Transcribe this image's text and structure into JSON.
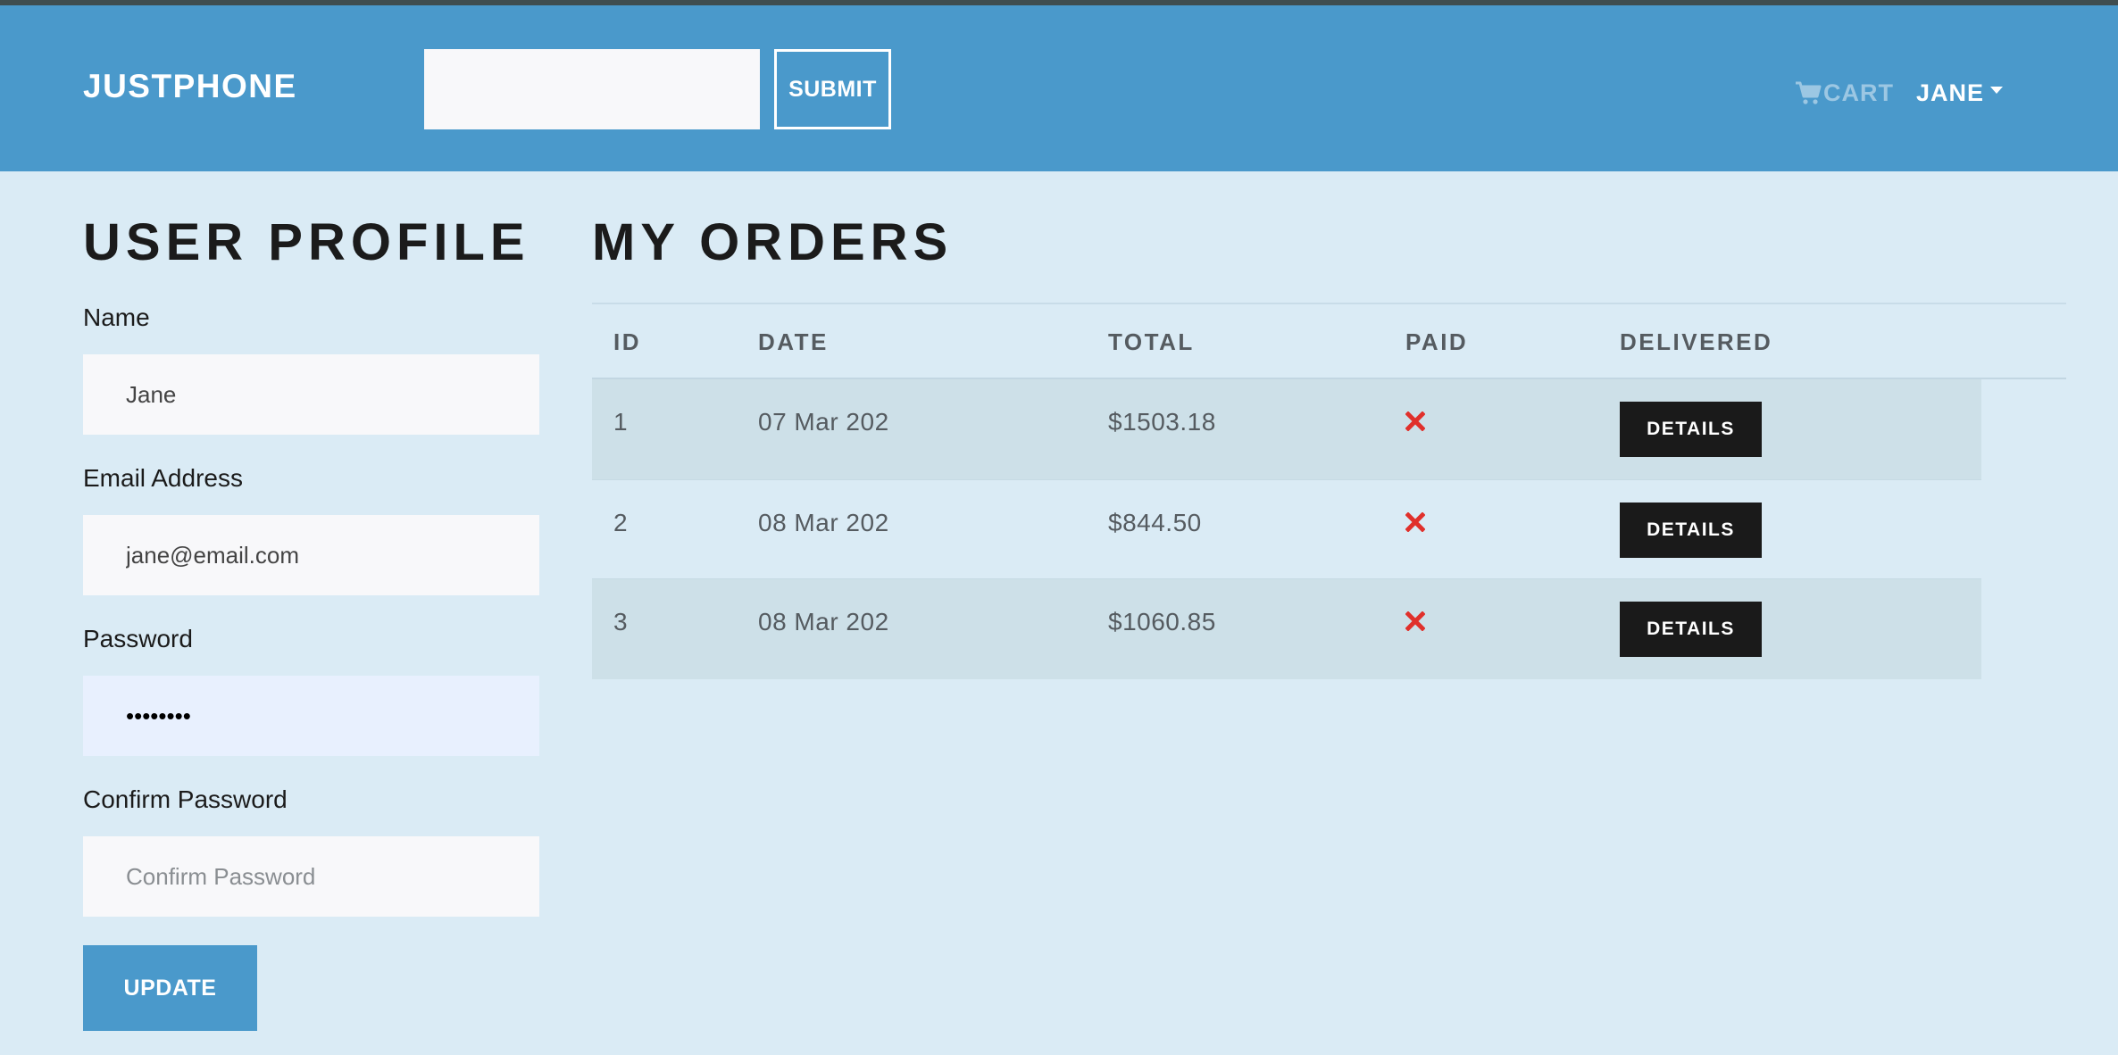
{
  "navbar": {
    "brand": "JUSTPHONE",
    "search": {
      "value": "",
      "placeholder": ""
    },
    "submit_label": "SUBMIT",
    "cart_label": "CART",
    "user_label": "JANE"
  },
  "profile": {
    "title": "USER PROFILE",
    "name_label": "Name",
    "name_value": "Jane",
    "email_label": "Email Address",
    "email_value": "jane@email.com",
    "password_label": "Password",
    "password_value": "********",
    "confirm_label": "Confirm Password",
    "confirm_placeholder": "Confirm Password",
    "update_label": "UPDATE"
  },
  "orders": {
    "title": "MY ORDERS",
    "headers": {
      "id": "ID",
      "date": "DATE",
      "total": "TOTAL",
      "paid": "PAID",
      "delivered": "DELIVERED"
    },
    "details_label": "DETAILS",
    "rows": [
      {
        "id": "1",
        "date": "07 Mar 202",
        "total": "$1503.18",
        "paid": false
      },
      {
        "id": "2",
        "date": "08 Mar 202",
        "total": "$844.50",
        "paid": false
      },
      {
        "id": "3",
        "date": "08 Mar 202",
        "total": "$1060.85",
        "paid": false
      }
    ]
  },
  "colors": {
    "navbar": "#4a99cb",
    "page_background": "#daebf5",
    "unpaid_icon": "#e0302b",
    "details_button": "#1a1a1a"
  },
  "icons": {
    "cart": "shopping-cart-icon",
    "unpaid": "x-mark-icon",
    "user_menu": "caret-down-icon"
  }
}
